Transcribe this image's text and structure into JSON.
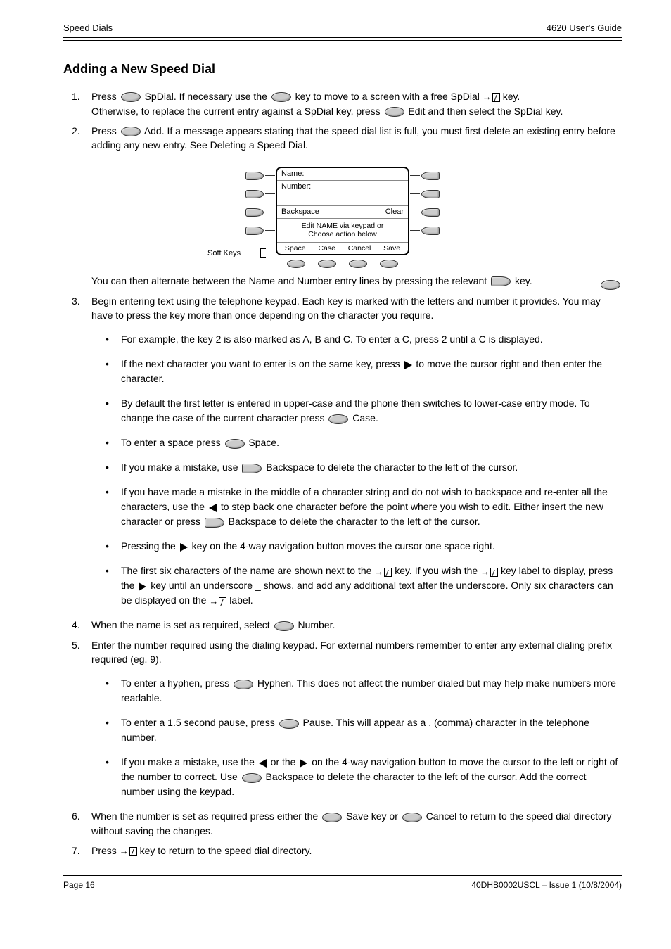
{
  "header": {
    "left": "Speed Dials",
    "right": "4620 User's Guide"
  },
  "section_title": "Adding a New Speed Dial",
  "steps": {
    "s1": "Press",
    "s1b": "SpDial. If necessary use the",
    "s1c": "key to move to a screen with a free SpDial",
    "s1d": "key.",
    "s1_alt": "Otherwise, to replace the current entry against a SpDial key, press",
    "s1_alt2": "Edit and then select the SpDial key.",
    "skey_row3": "row3",
    "s2": "Press",
    "s2b": "Add. If a message appears stating that the speed dial list is full, you must first delete an existing entry before adding any new entry. See Deleting a Speed Dial.",
    "lcd": {
      "name_label": "Name:",
      "number_label": "Number:",
      "backspace": "Backspace",
      "clear": "Clear",
      "msg1": "Edit NAME via keypad or",
      "msg2": "Choose action below",
      "k1": "Space",
      "k2": "Case",
      "k3": "Cancel",
      "k4": "Save"
    },
    "softkeys_label": "Soft Keys",
    "row5a": "You can then alternate between the Name and Number entry lines by pressing the relevant",
    "row5b": "key.",
    "s3": "Begin entering text using the telephone keypad. Each key is marked with the letters and number it provides. You may have to press the key more than once depending on the character you require.",
    "b1": "For example, the key 2 is also marked as A, B and C. To enter a C, press 2 until a C is displayed.",
    "b2": "If the next character you want to enter is on the same key, press",
    "b2b": "to move the cursor right and then enter the character.",
    "b3": "By default the first letter is entered in upper-case and the phone then switches to lower-case entry mode. To change the case of the current character press",
    "b3b": "Case.",
    "b4": "To enter a space press",
    "b4b": "Space.",
    "b5": "If you make a mistake, use",
    "b5b": "Backspace to delete the character to the left of the cursor.",
    "b6": "If you have made a mistake in the middle of a character string and do not wish to backspace and re-enter all the characters, use the",
    "b6b": "to step back one character before the point where you wish to edit. Either insert the new character or press",
    "b6c": "Backspace to delete the character to the left of the cursor.",
    "b7": "Pressing the",
    "b7b": "key on the 4-way navigation button moves the cursor one space right.",
    "b8": "The first six characters of the name are shown next to the",
    "b8b": "key. If you wish the",
    "b8c": "key label to display, press the",
    "b8d": "key until an underscore _ shows, and add any additional text after the underscore. Only six characters can be displayed on the",
    "b8e": "label.",
    "s4l": "When the name is set as required, select",
    "s4r": "Number.",
    "s5l": "Enter the number required using the dialing keypad. For external numbers remember to enter any external dialing prefix required (eg. 9).",
    "s5b1": "To enter a hyphen, press",
    "s5b1b": "Hyphen. This does not affect the number dialed but may help make numbers more readable.",
    "s5b2": "To enter a 1.5 second pause, press",
    "s5b2b": "Pause. This will appear as a , (comma) character in the telephone number.",
    "s5b3a": "If you make a mistake, use the",
    "s5b3b": "or the",
    "s5b3c": "on the 4-way navigation button to move the cursor to the left or right of the number to correct. Use",
    "s5b3d": "Backspace to delete the character to the left of the cursor. Add the correct number using the keypad.",
    "s6a": "When the number is set as required press either the",
    "s6b": "Save key or",
    "s6c": "Cancel to return to the speed dial directory without saving the changes.",
    "s7": "key to return to the speed dial directory.",
    "s7a": "Press"
  },
  "footer": {
    "left": "Page 16",
    "right": "40DHB0002USCL – Issue 1 (10/8/2004)"
  }
}
